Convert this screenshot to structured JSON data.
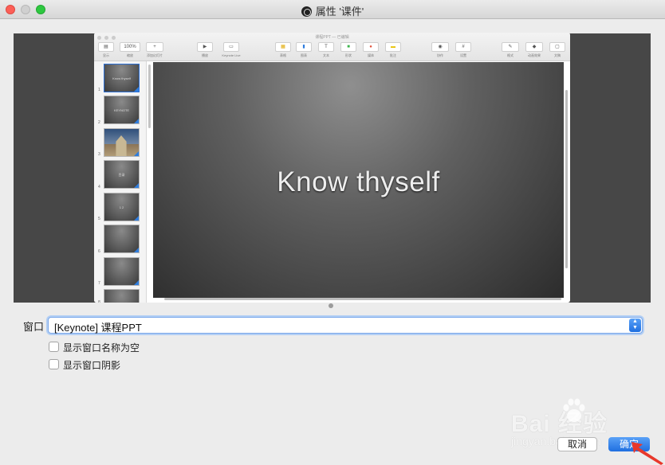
{
  "window": {
    "title": "属性 '课件'"
  },
  "preview": {
    "keynote": {
      "doc_title": "课程PPT — 已编辑",
      "toolbar": [
        {
          "icon": "view-icon",
          "label": "显示"
        },
        {
          "icon": "zoom-icon",
          "value": "100%",
          "label": "缩放"
        },
        {
          "icon": "add-slide-icon",
          "label": "添加幻灯片"
        },
        {
          "icon": "play-icon",
          "label": "播放"
        },
        {
          "icon": "keynote-live-icon",
          "label": "Keynote Live"
        },
        {
          "icon": "table-icon",
          "label": "表格"
        },
        {
          "icon": "chart-icon",
          "label": "图表"
        },
        {
          "icon": "text-icon",
          "label": "文本"
        },
        {
          "icon": "shape-icon",
          "label": "形状"
        },
        {
          "icon": "media-icon",
          "label": "媒体"
        },
        {
          "icon": "comment-icon",
          "label": "批注"
        },
        {
          "icon": "collaborate-icon",
          "label": "协作"
        },
        {
          "icon": "grid-icon",
          "label": "设置"
        },
        {
          "icon": "format-icon",
          "label": "格式"
        },
        {
          "icon": "animate-icon",
          "label": "动画效果"
        },
        {
          "icon": "document-icon",
          "label": "文稿"
        }
      ],
      "thumbnails": [
        {
          "num": "1",
          "text": "Know thyself"
        },
        {
          "num": "2",
          "text": "KEYNOTE"
        },
        {
          "num": "3",
          "text": ""
        },
        {
          "num": "4",
          "text": "目录"
        },
        {
          "num": "5",
          "text": "1 2"
        },
        {
          "num": "6",
          "text": ""
        },
        {
          "num": "7",
          "text": ""
        },
        {
          "num": "8",
          "text": ""
        }
      ],
      "slide_text": "Know thyself"
    }
  },
  "form": {
    "window_label": "窗口",
    "window_value": "[Keynote] 课程PPT",
    "checkbox_empty_name": "显示窗口名称为空",
    "checkbox_shadow": "显示窗口阴影"
  },
  "buttons": {
    "cancel": "取消",
    "ok": "确定"
  },
  "watermark": {
    "brand": "Bai 经验",
    "url": "jingyan.baidu.com"
  }
}
